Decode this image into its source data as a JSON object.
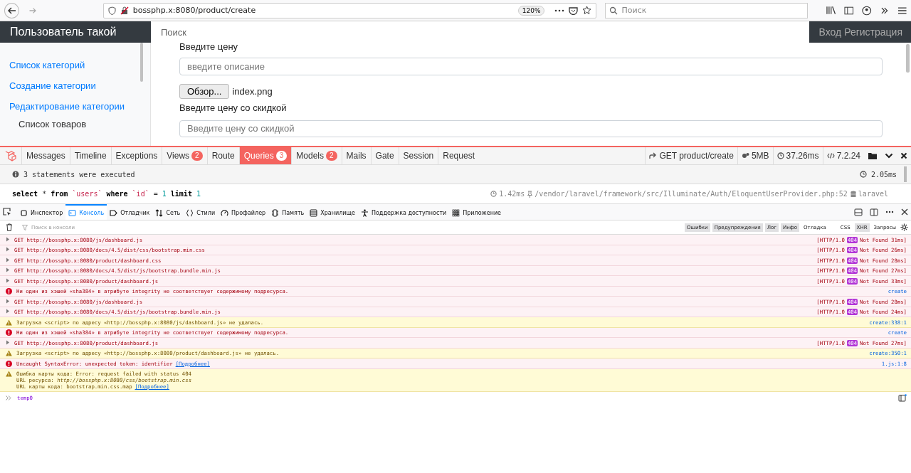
{
  "browser": {
    "url": "bossphp.x:8080/product/create",
    "zoom": "120%",
    "search_placeholder": "Поиск"
  },
  "navbar": {
    "brand": "Пользователь такой",
    "search_placeholder": "Поиск",
    "auth": "Вход Регистрация"
  },
  "sidebar": {
    "links": [
      "Список категорий",
      "Создание категории",
      "Редактирование категории"
    ],
    "heading": "Список товаров"
  },
  "form": {
    "price_label": "Введите цену",
    "description_placeholder": "введите описание",
    "browse_button": "Обзор...",
    "file_name": "index.png",
    "discount_label": "Введите цену со скидкой",
    "discount_placeholder": "Введите цену со скидкой"
  },
  "debugbar": {
    "tabs": [
      {
        "label": "Messages",
        "selected": false
      },
      {
        "label": "Timeline",
        "selected": false
      },
      {
        "label": "Exceptions",
        "selected": false
      },
      {
        "label": "Views",
        "count": "2",
        "selected": false
      },
      {
        "label": "Route",
        "selected": false
      },
      {
        "label": "Queries",
        "count": "3",
        "selected": true
      },
      {
        "label": "Models",
        "count": "2",
        "selected": false
      },
      {
        "label": "Mails",
        "selected": false
      },
      {
        "label": "Gate",
        "selected": false
      },
      {
        "label": "Session",
        "selected": false
      },
      {
        "label": "Request",
        "selected": false
      }
    ],
    "request": "GET product/create",
    "memory": "5MB",
    "time": "37.26ms",
    "php": "7.2.24",
    "summary": "3 statements were executed",
    "total_time": "2.05ms",
    "query": {
      "parts": [
        {
          "kind": "keyword",
          "text": "select"
        },
        {
          "kind": "plain",
          "text": " * "
        },
        {
          "kind": "keyword",
          "text": "from"
        },
        {
          "kind": "ident",
          "text": " `users` "
        },
        {
          "kind": "keyword",
          "text": "where"
        },
        {
          "kind": "ident",
          "text": " `id`"
        },
        {
          "kind": "plain",
          "text": " = "
        },
        {
          "kind": "number",
          "text": "1 "
        },
        {
          "kind": "keyword",
          "text": "limit"
        },
        {
          "kind": "number",
          "text": " 1"
        }
      ],
      "duration": "1.42ms",
      "source": "/vendor/laravel/framework/src/Illuminate/Auth/EloquentUserProvider.php:52",
      "connection": "laravel"
    }
  },
  "devtools": {
    "tabs": [
      {
        "label": "Инспектор",
        "selected": false
      },
      {
        "label": "Консоль",
        "selected": true
      },
      {
        "label": "Отладчик",
        "selected": false
      },
      {
        "label": "Сеть",
        "selected": false
      },
      {
        "label": "Стили",
        "selected": false
      },
      {
        "label": "Профайлер",
        "selected": false
      },
      {
        "label": "Память",
        "selected": false
      },
      {
        "label": "Хранилище",
        "selected": false
      },
      {
        "label": "Поддержка доступности",
        "selected": false
      },
      {
        "label": "Приложение",
        "selected": false
      }
    ],
    "filter_placeholder": "Поиск в консоли",
    "levels": [
      {
        "label": "Ошибки",
        "selected": true
      },
      {
        "label": "Предупреждения",
        "selected": true
      },
      {
        "label": "Лог",
        "selected": true
      },
      {
        "label": "Инфо",
        "selected": true
      },
      {
        "label": "Отладка",
        "selected": false
      }
    ],
    "types": [
      {
        "label": "CSS",
        "selected": false
      },
      {
        "label": "XHR",
        "selected": true
      },
      {
        "label": "Запросы",
        "selected": false
      }
    ],
    "messages": [
      {
        "kind": "net",
        "text": "GET http://bossphp.x:8080/js/dashboard.js",
        "protocol": "[HTTP/1.0",
        "code": "404",
        "status": "Not Found 31ms]"
      },
      {
        "kind": "net",
        "text": "GET http://bossphp.x:8080/docs/4.5/dist/css/bootstrap.min.css",
        "protocol": "[HTTP/1.0",
        "code": "404",
        "status": "Not Found 26ms]"
      },
      {
        "kind": "net",
        "text": "GET http://bossphp.x:8080/product/dashboard.css",
        "protocol": "[HTTP/1.0",
        "code": "404",
        "status": "Not Found 28ms]"
      },
      {
        "kind": "net",
        "text": "GET http://bossphp.x:8080/docs/4.5/dist/js/bootstrap.bundle.min.js",
        "protocol": "[HTTP/1.0",
        "code": "404",
        "status": "Not Found 27ms]"
      },
      {
        "kind": "net",
        "text": "GET http://bossphp.x:8080/product/dashboard.js",
        "protocol": "[HTTP/1.0",
        "code": "404",
        "status": "Not Found 33ms]"
      },
      {
        "kind": "error",
        "text": "Ни один из хэшей «sha384» в атрибуте integrity не соответствует содержимому подресурса.",
        "location": "create"
      },
      {
        "kind": "net",
        "text": "GET http://bossphp.x:8080/js/dashboard.js",
        "protocol": "[HTTP/1.0",
        "code": "404",
        "status": "Not Found 28ms]"
      },
      {
        "kind": "net",
        "text": "GET http://bossphp.x:8080/docs/4.5/dist/js/bootstrap.bundle.min.js",
        "protocol": "[HTTP/1.0",
        "code": "404",
        "status": "Not Found 24ms]"
      },
      {
        "kind": "warning",
        "text": "Загрузка <script> по адресу «http://bossphp.x:8080/js/dashboard.js» не удалась.",
        "location": "create:338:1"
      },
      {
        "kind": "error",
        "text": "Ни один из хэшей «sha384» в атрибуте integrity не соответствует содержимому подресурса.",
        "location": "create"
      },
      {
        "kind": "net",
        "text": "GET http://bossphp.x:8080/product/dashboard.js",
        "protocol": "[HTTP/1.0",
        "code": "404",
        "status": "Not Found 27ms]"
      },
      {
        "kind": "warning",
        "text": "Загрузка <script> по адресу «http://bossphp.x:8080/product/dashboard.js» не удалась.",
        "location": "create:350:1"
      },
      {
        "kind": "error",
        "text": "Uncaught SyntaxError: unexpected token: identifier",
        "link": "[Подробнее]",
        "location": "1.js:1:8"
      },
      {
        "kind": "warning",
        "lines": [
          {
            "text": "Ошибка карты кода: Error: request failed with status 404"
          },
          {
            "text": "URL ресурса: *http://bossphp.x:8080/css/bootstrap.min.css*"
          },
          {
            "text": "URL карты кода: bootstrap.min.css.map",
            "link": "[Подробнее]"
          }
        ]
      }
    ],
    "input": "temp0"
  }
}
